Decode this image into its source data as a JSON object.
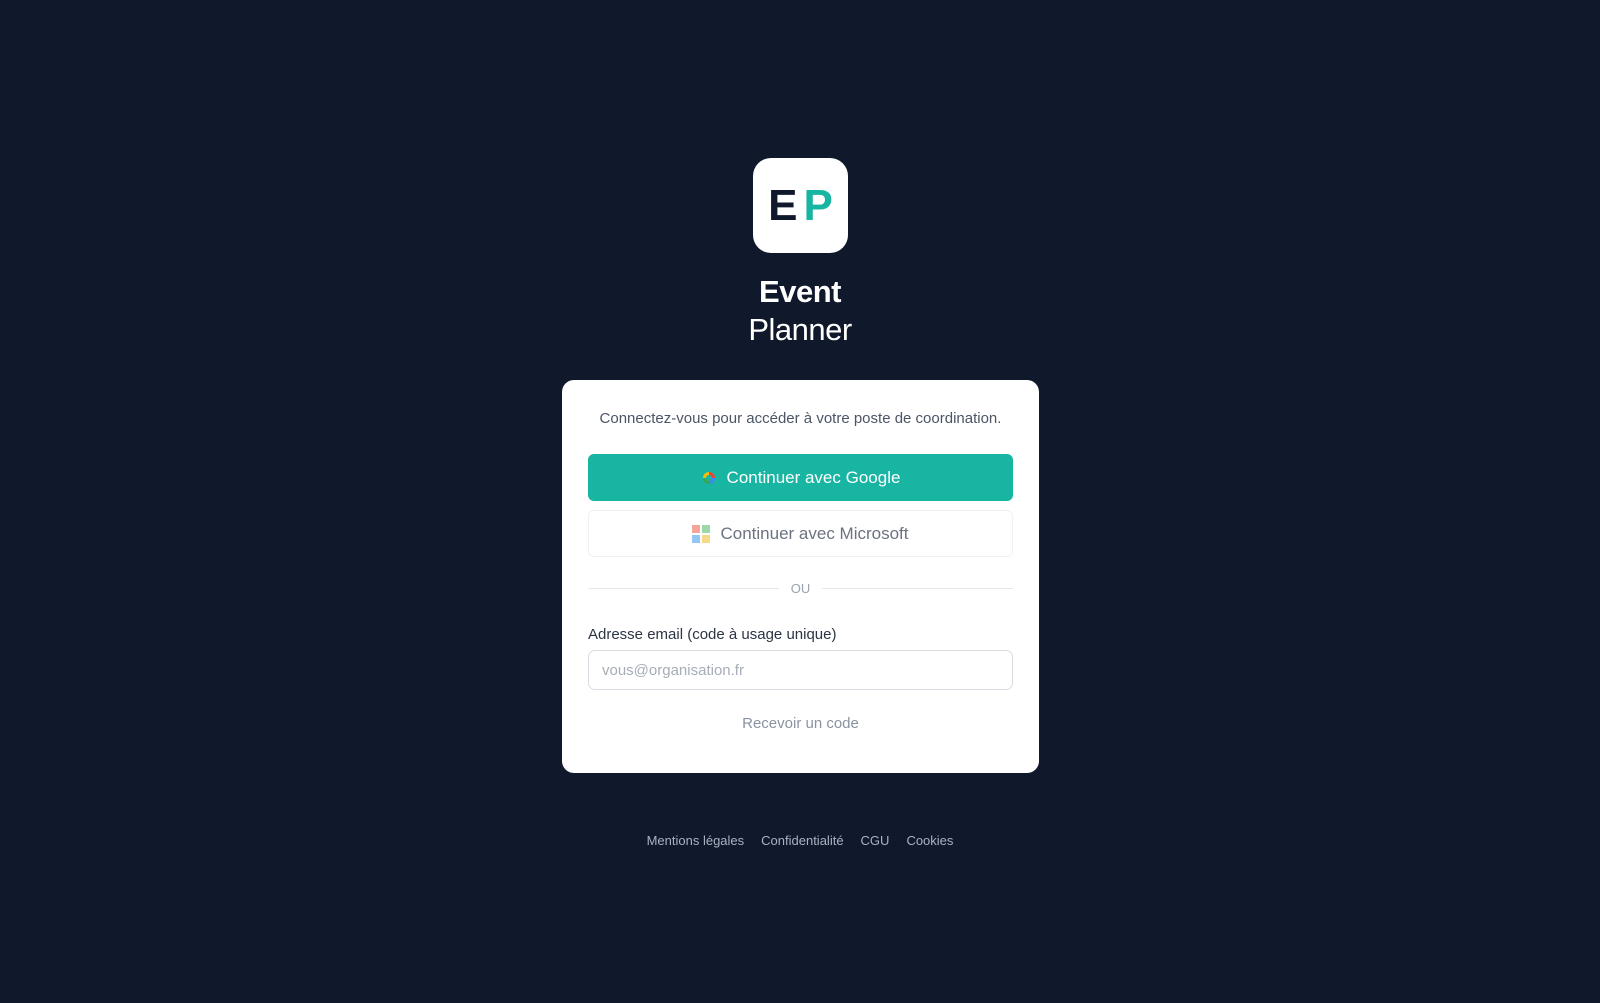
{
  "brand": {
    "logo_letter_1": "E",
    "logo_letter_2": "P",
    "title": "Event",
    "subtitle": "Planner",
    "colors": {
      "background": "#10182b",
      "accent": "#19b5a3"
    }
  },
  "card": {
    "intro": "Connectez-vous pour accéder à votre poste de coordination.",
    "google_button": {
      "label": "Continuer avec Google",
      "icon": "google-icon"
    },
    "microsoft_button": {
      "label": "Continuer avec Microsoft",
      "icon": "microsoft-icon"
    },
    "divider_text": "OU",
    "email": {
      "label": "Adresse email (code à usage unique)",
      "placeholder": "vous@organisation.fr",
      "value": ""
    },
    "request_code_label": "Recevoir un code"
  },
  "footer": {
    "links": [
      "Mentions légales",
      "Confidentialité",
      "CGU",
      "Cookies"
    ]
  }
}
